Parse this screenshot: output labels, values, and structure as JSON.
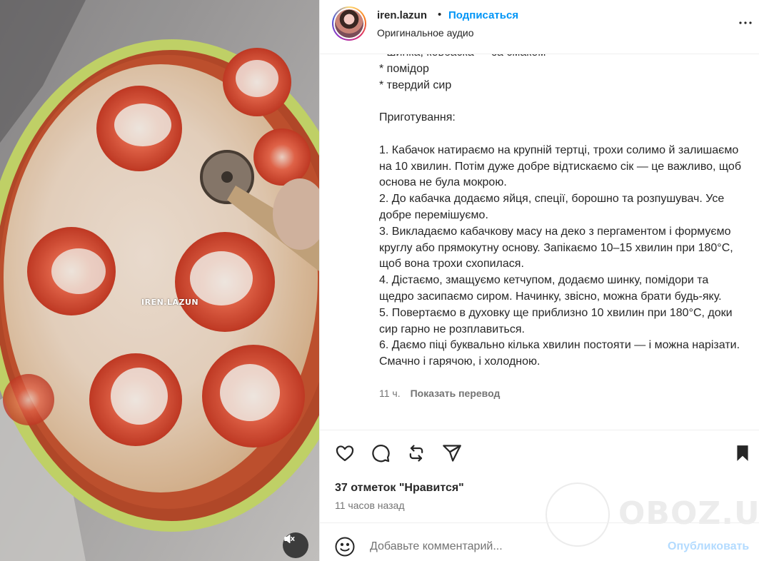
{
  "post": {
    "username": "iren.lazun",
    "separator": "•",
    "follow_label": "Подписаться",
    "audio_label": "Оригинальное аудио",
    "more_icon": "more-horizontal-icon"
  },
  "media": {
    "watermark": "IREN.LAZUN",
    "mute_icon": "volume-muted-icon"
  },
  "caption": {
    "text": "* шинка, ковбаска — за смаком\n* помідор\n* твердий сир\n\nПриготування:\n\n1. Кабачок натираємо на крупній тертці, трохи солимо й залишаємо на 10 хвилин. Потім дуже добре відтискаємо сік — це важливо, щоб основа не була мокрою.\n2. До кабачка додаємо яйця, спеції, борошно та розпушувач. Усе добре перемішуємо.\n3. Викладаємо кабачкову масу на деко з пергаментом і формуємо круглу або прямокутну основу. Запікаємо 10–15 хвилин при 180°C, щоб вона трохи схопилася.\n4. Дістаємо, змащуємо кетчупом, додаємо шинку, помідори та щедро засипаємо сиром. Начинку, звісно, можна брати будь-яку.\n5. Повертаємо в духовку ще приблизно 10 хвилин при 180°C, доки сир гарно не розплавиться.\n6. Даємо піці буквально кілька хвилин постояти — і можна нарізати. Смачно і гарячою, і холодною.",
    "age": "11 ч.",
    "translate_label": "Показать перевод"
  },
  "actions": {
    "like_icon": "heart-icon",
    "comment_icon": "comment-icon",
    "repost_icon": "repost-icon",
    "share_icon": "send-icon",
    "save_icon": "bookmark-icon",
    "likes_text": "37 отметок \"Нравится\"",
    "posted_text": "11 часов назад"
  },
  "watermark_site": "OBOZ.UA",
  "comment": {
    "placeholder": "Добавьте комментарий...",
    "publish_label": "Опубликовать",
    "emoji_icon": "smiley-icon"
  },
  "colors": {
    "link_blue": "#0095f6",
    "publish_disabled": "#b3dbff",
    "secondary_text": "#737373",
    "divider": "#efefef"
  }
}
